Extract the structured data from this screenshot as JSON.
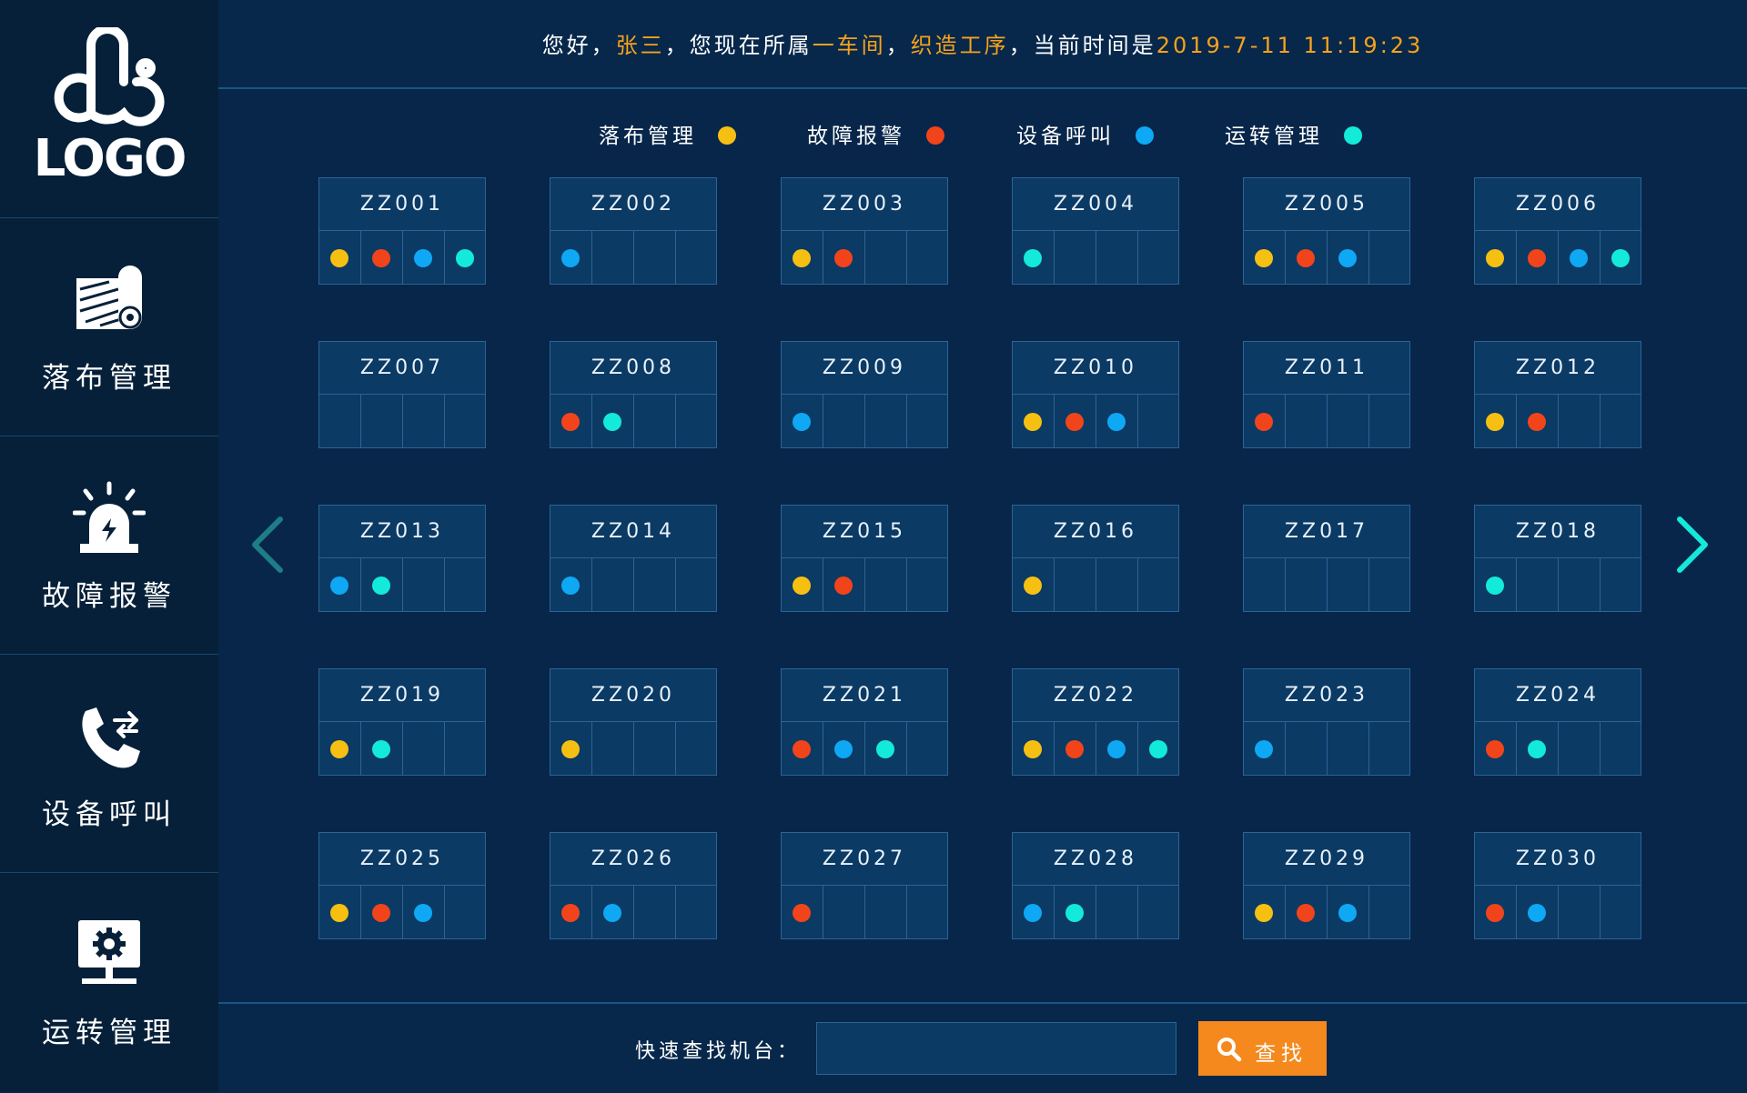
{
  "brand": {
    "logo_text": "LOGO"
  },
  "colors": {
    "yellow": "#f6c012",
    "red": "#f2441b",
    "blue": "#0ea8f4",
    "cyan": "#14ead9",
    "highlight": "#f7a21b",
    "search_button": "#f5891e"
  },
  "sidebar": {
    "items": [
      {
        "label": "落布管理",
        "icon": "cloth-roll-icon"
      },
      {
        "label": "故障报警",
        "icon": "alarm-light-icon"
      },
      {
        "label": "设备呼叫",
        "icon": "phone-call-icon"
      },
      {
        "label": "运转管理",
        "icon": "monitor-gear-icon"
      }
    ]
  },
  "header": {
    "prefix": "您好，",
    "user": "张三",
    "mid1": "，您现在所属",
    "workshop": "一车间",
    "sep": "，",
    "process": "织造工序",
    "mid2": "，当前时间是",
    "datetime": "2019-7-11 11:19:23"
  },
  "legend": [
    {
      "label": "落布管理",
      "color": "yellow"
    },
    {
      "label": "故障报警",
      "color": "red"
    },
    {
      "label": "设备呼叫",
      "color": "blue"
    },
    {
      "label": "运转管理",
      "color": "cyan"
    }
  ],
  "machines": [
    {
      "id": "ZZ001",
      "dots": [
        "yellow",
        "red",
        "blue",
        "cyan"
      ]
    },
    {
      "id": "ZZ002",
      "dots": [
        "blue"
      ]
    },
    {
      "id": "ZZ003",
      "dots": [
        "yellow",
        "red"
      ]
    },
    {
      "id": "ZZ004",
      "dots": [
        "cyan"
      ]
    },
    {
      "id": "ZZ005",
      "dots": [
        "yellow",
        "red",
        "blue"
      ]
    },
    {
      "id": "ZZ006",
      "dots": [
        "yellow",
        "red",
        "blue",
        "cyan"
      ]
    },
    {
      "id": "ZZ007",
      "dots": []
    },
    {
      "id": "ZZ008",
      "dots": [
        "red",
        "cyan"
      ]
    },
    {
      "id": "ZZ009",
      "dots": [
        "blue"
      ]
    },
    {
      "id": "ZZ010",
      "dots": [
        "yellow",
        "red",
        "blue"
      ]
    },
    {
      "id": "ZZ011",
      "dots": [
        "red"
      ]
    },
    {
      "id": "ZZ012",
      "dots": [
        "yellow",
        "red"
      ]
    },
    {
      "id": "ZZ013",
      "dots": [
        "blue",
        "cyan"
      ]
    },
    {
      "id": "ZZ014",
      "dots": [
        "blue"
      ]
    },
    {
      "id": "ZZ015",
      "dots": [
        "yellow",
        "red"
      ]
    },
    {
      "id": "ZZ016",
      "dots": [
        "yellow"
      ]
    },
    {
      "id": "ZZ017",
      "dots": []
    },
    {
      "id": "ZZ018",
      "dots": [
        "cyan"
      ]
    },
    {
      "id": "ZZ019",
      "dots": [
        "yellow",
        "cyan"
      ]
    },
    {
      "id": "ZZ020",
      "dots": [
        "yellow"
      ]
    },
    {
      "id": "ZZ021",
      "dots": [
        "red",
        "blue",
        "cyan"
      ]
    },
    {
      "id": "ZZ022",
      "dots": [
        "yellow",
        "red",
        "blue",
        "cyan"
      ]
    },
    {
      "id": "ZZ023",
      "dots": [
        "blue"
      ]
    },
    {
      "id": "ZZ024",
      "dots": [
        "red",
        "cyan"
      ]
    },
    {
      "id": "ZZ025",
      "dots": [
        "yellow",
        "red",
        "blue"
      ]
    },
    {
      "id": "ZZ026",
      "dots": [
        "red",
        "blue"
      ]
    },
    {
      "id": "ZZ027",
      "dots": [
        "red"
      ]
    },
    {
      "id": "ZZ028",
      "dots": [
        "blue",
        "cyan"
      ]
    },
    {
      "id": "ZZ029",
      "dots": [
        "yellow",
        "red",
        "blue"
      ]
    },
    {
      "id": "ZZ030",
      "dots": [
        "red",
        "blue"
      ]
    }
  ],
  "nav": {
    "prev_icon": "chevron-left-icon",
    "next_icon": "chevron-right-icon"
  },
  "search": {
    "label": "快速查找机台：",
    "placeholder": "",
    "value": "",
    "button_label": "查找",
    "icon": "search-icon"
  }
}
